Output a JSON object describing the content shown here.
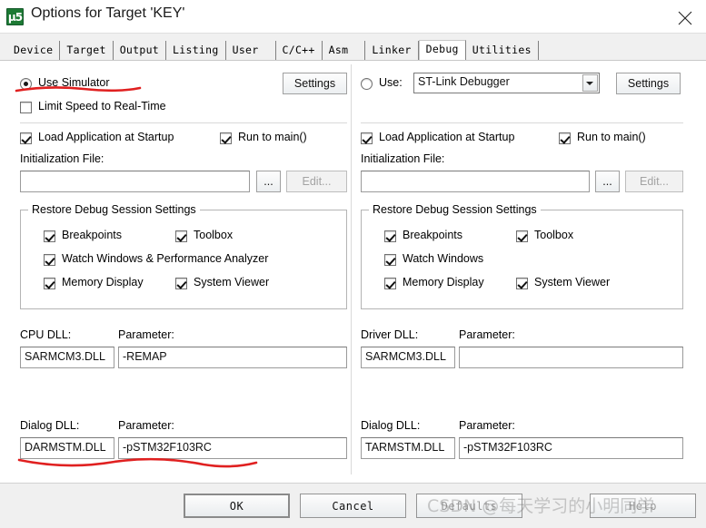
{
  "window": {
    "title": "Options for Target 'KEY'",
    "icon": "keil-uvision-logo-icon",
    "close_label": "close-icon"
  },
  "tabs": [
    {
      "label": "Device",
      "active": false
    },
    {
      "label": "Target",
      "active": false
    },
    {
      "label": "Output",
      "active": false
    },
    {
      "label": "Listing",
      "active": false
    },
    {
      "label": "User",
      "active": false
    },
    {
      "label": "C/C++",
      "active": false
    },
    {
      "label": "Asm",
      "active": false
    },
    {
      "label": "Linker",
      "active": false
    },
    {
      "label": "Debug",
      "active": true
    },
    {
      "label": "Utilities",
      "active": false
    }
  ],
  "left": {
    "use_simulator_label": "Use Simulator",
    "use_simulator_checked": true,
    "settings_label": "Settings",
    "limit_speed_label": "Limit Speed to Real-Time",
    "limit_speed_checked": false,
    "load_app_label": "Load Application at Startup",
    "load_app_checked": true,
    "run_to_main_label": "Run to main()",
    "run_to_main_checked": true,
    "init_file_label": "Initialization File:",
    "init_file_value": "",
    "browse_label": "...",
    "edit_label": "Edit...",
    "edit_disabled": true,
    "restore_group_title": "Restore Debug Session Settings",
    "restore_items": [
      {
        "label": "Breakpoints",
        "checked": true
      },
      {
        "label": "Toolbox",
        "checked": true
      },
      {
        "label": "Watch Windows & Performance Analyzer",
        "checked": true
      },
      {
        "label": "Memory Display",
        "checked": true
      },
      {
        "label": "System Viewer",
        "checked": true
      }
    ],
    "cpu_dll_label": "CPU DLL:",
    "cpu_dll_value": "SARMCM3.DLL",
    "cpu_param_label": "Parameter:",
    "cpu_param_value": "-REMAP",
    "dialog_dll_label": "Dialog DLL:",
    "dialog_dll_value": "DARMSTM.DLL",
    "dialog_param_label": "Parameter:",
    "dialog_param_value": "-pSTM32F103RC"
  },
  "right": {
    "use_label": "Use:",
    "use_checked": false,
    "debugger_selected": "ST-Link Debugger",
    "settings_label": "Settings",
    "load_app_label": "Load Application at Startup",
    "load_app_checked": true,
    "run_to_main_label": "Run to main()",
    "run_to_main_checked": true,
    "init_file_label": "Initialization File:",
    "init_file_value": "",
    "browse_label": "...",
    "edit_label": "Edit...",
    "edit_disabled": true,
    "restore_group_title": "Restore Debug Session Settings",
    "restore_items": [
      {
        "label": "Breakpoints",
        "checked": true
      },
      {
        "label": "Toolbox",
        "checked": true
      },
      {
        "label": "Watch Windows",
        "checked": true
      },
      {
        "label": "Memory Display",
        "checked": true
      },
      {
        "label": "System Viewer",
        "checked": true
      }
    ],
    "driver_dll_label": "Driver DLL:",
    "driver_dll_value": "SARMCM3.DLL",
    "driver_param_label": "Parameter:",
    "driver_param_value": "",
    "dialog_dll_label": "Dialog DLL:",
    "dialog_dll_value": "TARMSTM.DLL",
    "dialog_param_label": "Parameter:",
    "dialog_param_value": "-pSTM32F103RC"
  },
  "footer": {
    "ok_label": "OK",
    "cancel_label": "Cancel",
    "defaults_label": "Defaults",
    "help_label": "Help"
  },
  "watermark": {
    "text": "CSDN @每天学习的小明同学"
  },
  "colors": {
    "annotation_red": "#e02020",
    "dialog_background": "#f0f0f0",
    "panel_background": "#ffffff"
  }
}
